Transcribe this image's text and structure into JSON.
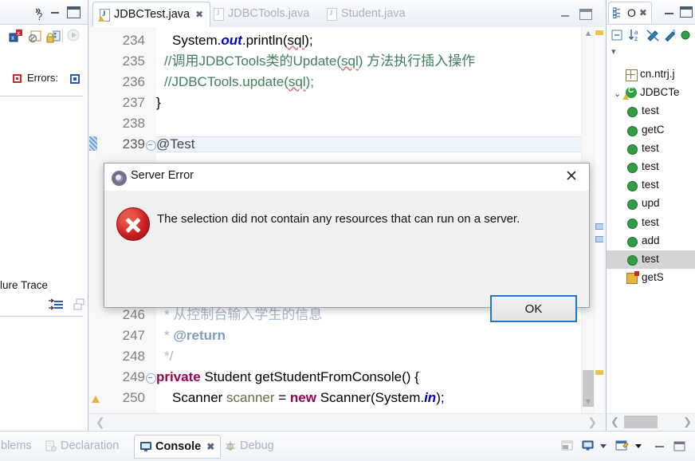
{
  "left_panel": {
    "toolbar_icons": [
      "fail-trace-icon",
      "disabled-stop-icon",
      "lock-scroll-icon",
      "rerun-icon"
    ],
    "errors_label": "Errors:",
    "errors_badge_icon": "error-badge-icon",
    "failure_trace_label": "lure Trace",
    "failure_trace_icons": [
      "filter-stack-icon",
      "copy-trace-icon"
    ],
    "chevron_icon": "chevron-more-icon",
    "minimize_icon": "minimize-icon",
    "maximize_icon": "maximize-icon"
  },
  "editor": {
    "tabs": [
      {
        "label": "JDBCTest.java",
        "active": true,
        "dirty_warn": true,
        "close_icon": "close-icon"
      },
      {
        "label": "JDBCTools.java",
        "active": false,
        "dirty_warn": false,
        "close_icon": "close-icon"
      },
      {
        "label": "Student.java",
        "active": false,
        "dirty_warn": false,
        "close_icon": "close-icon"
      }
    ],
    "minimize_icon": "minimize-icon",
    "maximize_icon": "maximize-icon",
    "lines": [
      {
        "num": "234",
        "indent": 72,
        "fold": false,
        "current": false,
        "warn": false,
        "html": "System.<i class=\"fld\">out</i>.println(<span class=\"sqlsq\">sql</span>);"
      },
      {
        "num": "235",
        "indent": 62,
        "fold": false,
        "current": false,
        "warn": false,
        "html": "<span class=\"cmt\">//调用JDBCTools类的Update(<span class=\"sqlsq\">sql</span>) 方法执行插入操作</span>"
      },
      {
        "num": "236",
        "indent": 62,
        "fold": false,
        "current": false,
        "warn": false,
        "html": "<span class=\"cmt\">//JDBCTools.update(<span class=\"sqlsq\">sql</span>);</span>"
      },
      {
        "num": "237",
        "indent": 52,
        "fold": false,
        "current": false,
        "warn": false,
        "html": "}"
      },
      {
        "num": "238",
        "indent": 52,
        "fold": false,
        "current": false,
        "warn": false,
        "html": ""
      },
      {
        "num": "239",
        "indent": 52,
        "fold": true,
        "current": true,
        "warn": false,
        "html": "<span class=\"ann\">@Test</span>"
      },
      {
        "num": "246",
        "indent": 62,
        "fold": false,
        "current": false,
        "warn": false,
        "html": "<span class=\"jdoc\">* 从控制台输入学生的信息</span>"
      },
      {
        "num": "247",
        "indent": 62,
        "fold": false,
        "current": false,
        "warn": false,
        "html": "<span class=\"jdoc\">* </span><span class=\"jdoc-tag\">@return</span>"
      },
      {
        "num": "248",
        "indent": 62,
        "fold": false,
        "current": false,
        "warn": false,
        "html": "<span class=\"jdoc\">*/</span>"
      },
      {
        "num": "249",
        "indent": 52,
        "fold": true,
        "current": false,
        "warn": false,
        "html": "<span class=\"kw\">private</span> Student getStudentFromConsole() {"
      },
      {
        "num": "250",
        "indent": 72,
        "fold": false,
        "current": false,
        "warn": true,
        "html": "Scanner <span class=\"loc\">scanner</span> = <span class=\"kw\">new</span> Scanner(System.<i class=\"fld\">in</i>);"
      }
    ],
    "scroll_up_icon": "scroll-up-icon",
    "scroll_down_icon": "scroll-down-icon",
    "hscroll_left_icon": "scroll-left-icon",
    "hscroll_right_icon": "scroll-right-icon"
  },
  "outline": {
    "tab_label": "O",
    "tab_icon": "outline-icon",
    "close_icon": "close-icon",
    "minimize_icon": "minimize-icon",
    "maximize_icon": "maximize-icon",
    "toolbar_icons": [
      "collapse-all-icon",
      "sort-alphabetically-icon",
      "hide-fields-icon",
      "hide-static-icon",
      "hide-nonpublic-icon"
    ],
    "menu_arrow_icon": "view-menu-icon",
    "items": [
      {
        "label": "cn.ntrj.j",
        "icon": "package-icon",
        "selected": false,
        "indent": 0
      },
      {
        "label": "JDBCTe",
        "icon": "class-icon",
        "selected": false,
        "indent": 0,
        "twisty": "⌄"
      },
      {
        "label": "test",
        "icon": "method-public-icon",
        "selected": false,
        "indent": 1
      },
      {
        "label": "getC",
        "icon": "method-public-icon",
        "selected": false,
        "indent": 1
      },
      {
        "label": "test",
        "icon": "method-public-icon",
        "selected": false,
        "indent": 1
      },
      {
        "label": "test",
        "icon": "method-public-icon",
        "selected": false,
        "indent": 1
      },
      {
        "label": "test",
        "icon": "method-public-icon",
        "selected": false,
        "indent": 1
      },
      {
        "label": "upd",
        "icon": "method-public-icon",
        "selected": false,
        "indent": 1
      },
      {
        "label": "test",
        "icon": "method-public-icon",
        "selected": false,
        "indent": 1
      },
      {
        "label": "add",
        "icon": "method-public-icon",
        "selected": false,
        "indent": 1
      },
      {
        "label": "test",
        "icon": "method-public-icon",
        "selected": true,
        "indent": 1
      },
      {
        "label": "getS",
        "icon": "method-private-icon",
        "selected": false,
        "indent": 1
      }
    ],
    "hscroll_left_icon": "scroll-left-icon",
    "hscroll_right_icon": "scroll-right-icon"
  },
  "bottom_tabs": [
    {
      "label": "blems",
      "icon": "problems-icon",
      "active": false
    },
    {
      "label": "Declaration",
      "icon": "declaration-icon",
      "active": false
    },
    {
      "label": "Console",
      "icon": "console-icon",
      "active": true,
      "close_icon": "close-icon"
    },
    {
      "label": "Debug",
      "icon": "debug-icon",
      "active": false
    }
  ],
  "bottom_toolbar_icons": [
    "clear-console-icon",
    "display-console-icon",
    "display-dropdown-icon",
    "open-console-icon",
    "open-dropdown-icon",
    "minimize-icon",
    "maximize-icon"
  ],
  "dialog": {
    "title": "Server Error",
    "title_icon": "server-error-icon",
    "close_icon": "close-icon",
    "message": "The selection did not contain any resources that can run on a server.",
    "error_icon": "error-circle-icon",
    "ok_label": "OK"
  },
  "colors": {
    "accent_blue": "#2076c8",
    "error_red": "#cf2020",
    "keyword": "#9c0050",
    "comment": "#3f7f5f",
    "field": "#0000c0",
    "selection_gray": "#d4d4d4"
  }
}
